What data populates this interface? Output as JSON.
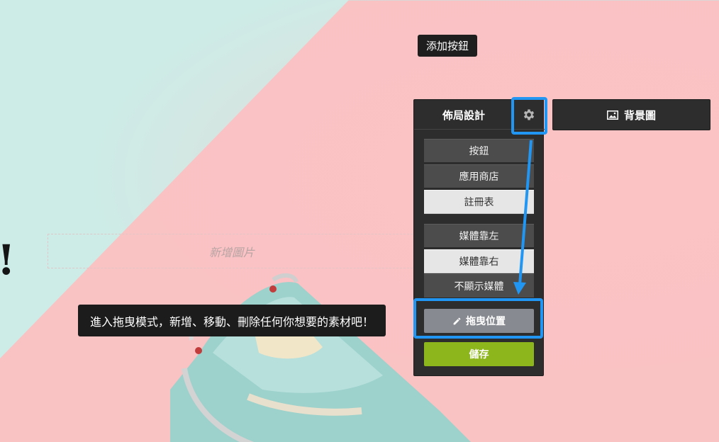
{
  "tooltip_top": "添加按鈕",
  "canvas": {
    "exclaim": "!",
    "image_placeholder": "新增圖片"
  },
  "panel": {
    "title": "佈局設計",
    "options_group1": [
      "按鈕",
      "應用商店",
      "註冊表"
    ],
    "options_group2": [
      "媒體靠左",
      "媒體靠右",
      "不顯示媒體"
    ],
    "drag_label": "拖曳位置",
    "save_label": "儲存"
  },
  "background_button": "背景圖",
  "tooltip_side": "進入拖曳模式，新增、移動、刪除任何你想要的素材吧！",
  "colors": {
    "accent": "#2196f3",
    "save": "#8db51c",
    "panel": "#2d2d2d",
    "mint": "#cdece7",
    "pink": "#f9c2c3"
  },
  "icons": [
    "gear-icon",
    "image-icon",
    "pencil-icon"
  ]
}
